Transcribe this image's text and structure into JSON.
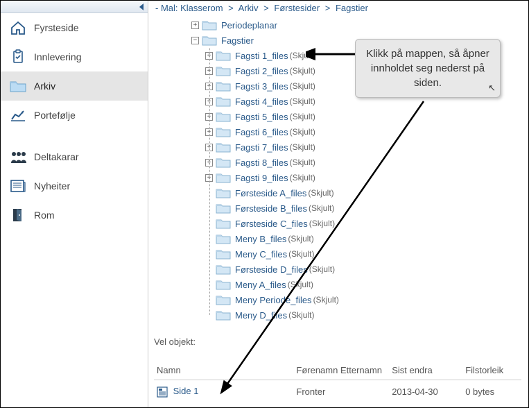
{
  "sidebar": {
    "items": [
      {
        "label": "Fyrsteside",
        "icon": "home"
      },
      {
        "label": "Innlevering",
        "icon": "clipboard"
      },
      {
        "label": "Arkiv",
        "icon": "folder",
        "active": true
      },
      {
        "label": "Portefølje",
        "icon": "chart"
      }
    ],
    "items2": [
      {
        "label": "Deltakarar",
        "icon": "people"
      },
      {
        "label": "Nyheiter",
        "icon": "news"
      },
      {
        "label": "Rom",
        "icon": "door"
      }
    ]
  },
  "breadcrumb": {
    "prefix": "- Mal: Klasserom",
    "sep": ">",
    "crumbs": [
      "Arkiv",
      "Førstesider",
      "Fagstier"
    ]
  },
  "tree": {
    "periodeplanar": {
      "label": "Periodeplanar"
    },
    "fagstier": {
      "label": "Fagstier"
    },
    "fagsti_children": [
      {
        "label": "Fagsti 1_files",
        "suffix": "(Skjult)",
        "expandable": true
      },
      {
        "label": "Fagsti 2_files",
        "suffix": "(Skjult)",
        "expandable": true
      },
      {
        "label": "Fagsti 3_files",
        "suffix": "(Skjult)",
        "expandable": true
      },
      {
        "label": "Fagsti 4_files",
        "suffix": "(Skjult)",
        "expandable": true
      },
      {
        "label": "Fagsti 5_files",
        "suffix": "(Skjult)",
        "expandable": true
      },
      {
        "label": "Fagsti 6_files",
        "suffix": "(Skjult)",
        "expandable": true
      },
      {
        "label": "Fagsti 7_files",
        "suffix": "(Skjult)",
        "expandable": true
      },
      {
        "label": "Fagsti 8_files",
        "suffix": "(Skjult)",
        "expandable": true
      },
      {
        "label": "Fagsti 9_files",
        "suffix": "(Skjult)",
        "expandable": true
      },
      {
        "label": "Førsteside A_files",
        "suffix": "(Skjult)",
        "expandable": false
      },
      {
        "label": "Førsteside B_files",
        "suffix": "(Skjult)",
        "expandable": false
      },
      {
        "label": "Førsteside C_files",
        "suffix": "(Skjult)",
        "expandable": false
      },
      {
        "label": "Meny B_files",
        "suffix": "(Skjult)",
        "expandable": false
      },
      {
        "label": "Meny C_files",
        "suffix": "(Skjult)",
        "expandable": false
      },
      {
        "label": "Førsteside D_files",
        "suffix": "(Skjult)",
        "expandable": false
      },
      {
        "label": "Meny A_files",
        "suffix": "(Skjult)",
        "expandable": false
      },
      {
        "label": "Meny Periode_files",
        "suffix": "(Skjult)",
        "expandable": false
      },
      {
        "label": "Meny D_files",
        "suffix": "(Skjult)",
        "expandable": false
      }
    ]
  },
  "vel_label": "Vel objekt:",
  "table": {
    "headers": [
      "Namn",
      "Førenamn Etternamn",
      "Sist endra",
      "Filstorleik"
    ],
    "row": {
      "name": "Side 1",
      "author": "Fronter",
      "date": "2013-04-30",
      "size": "0 bytes"
    }
  },
  "callout": {
    "text": "Klikk på mappen, så åpner innholdet seg nederst på siden."
  }
}
